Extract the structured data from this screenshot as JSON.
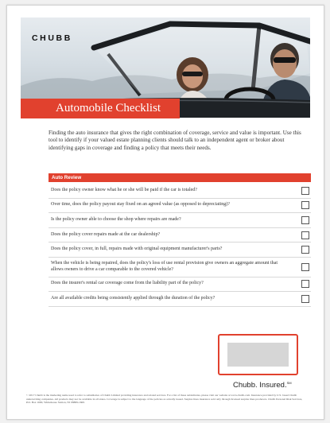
{
  "brand": {
    "logo_text": "CHUBB",
    "tagline": "Chubb. Insured.",
    "tagline_mark": "SM"
  },
  "title": "Automobile Checklist",
  "intro": "Finding the auto insurance that gives the right combination of coverage, service and value is important. Use this tool to identify if your valued estate planning clients should talk to an independent agent or broker about identifying gaps in coverage and finding a policy that meets their needs.",
  "checklist": {
    "header": "Auto Review",
    "items": [
      "Does the policy owner know what he or she will be paid if the car is totaled?",
      "Over time, does the policy payout stay fixed on an agreed value (as opposed to depreciating)?",
      "Is the policy owner able to choose the shop where repairs are made?",
      "Does the policy cover repairs made at the car dealership?",
      "Does the policy cover, in full, repairs made with original equipment manufacturer's parts?",
      "When the vehicle is being repaired, does the policy's loss of use rental provision give owners an aggregate amount that allows owners to drive a car comparable to the covered vehicle?",
      "Does the insurer's rental car coverage come from the liability part of the policy?",
      "Are all available credits being consistently applied through the duration of the policy?"
    ]
  },
  "disclaimer": "© 2017 Chubb is the marketing name used to refer to subsidiaries of Chubb Limited providing insurance and related services. For a list of these subsidiaries, please visit our website at www.chubb.com. Insurance provided by U.S. based Chubb underwriting companies. All products may not be available in all states. Coverage is subject to the language of the policies as actually issued. Surplus lines insurance sold only through licensed surplus lines producers. Chubb Personal Risk Services, P.O. Box 1600, Whitehouse Station, NJ 08889-1600.",
  "colors": {
    "accent": "#e1412e",
    "text": "#333333"
  }
}
